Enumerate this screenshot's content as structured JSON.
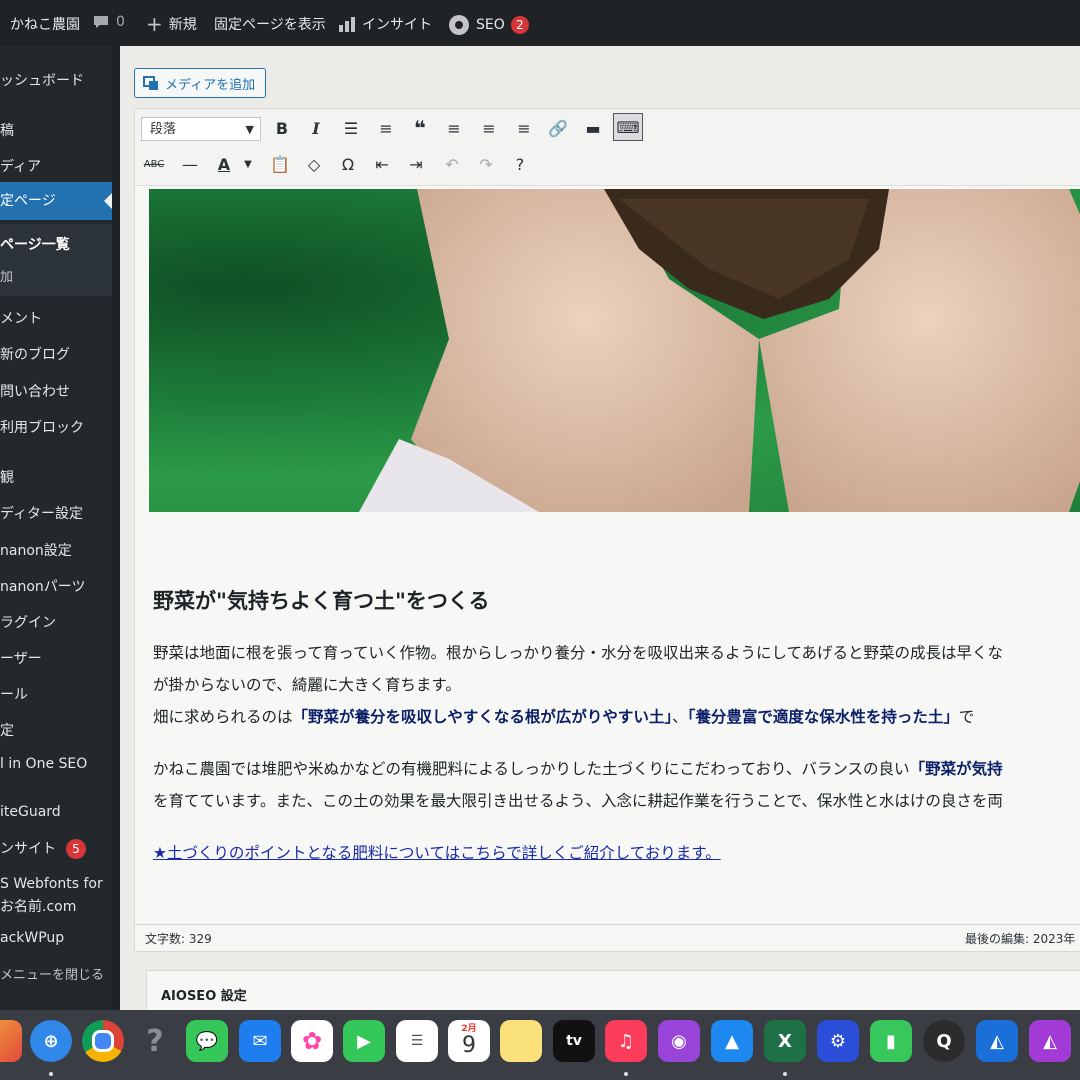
{
  "adminbar": {
    "site_name": "かねこ農園",
    "comments_count": "0",
    "new_label": "新規",
    "view_page_label": "固定ページを表示",
    "insight_label": "インサイト",
    "seo_label": "SEO",
    "seo_badge": "2"
  },
  "sidebar": {
    "items": [
      {
        "label": "ッシュボード"
      },
      {
        "label": "稿"
      },
      {
        "label": "ディア"
      },
      {
        "label": "定ページ"
      },
      {
        "label": "ページ一覧"
      },
      {
        "label": "加"
      },
      {
        "label": "メント"
      },
      {
        "label": "新のブログ"
      },
      {
        "label": "問い合わせ"
      },
      {
        "label": "利用ブロック"
      },
      {
        "label": "観"
      },
      {
        "label": "ディター設定"
      },
      {
        "label": "nanon設定"
      },
      {
        "label": "nanonパーツ"
      },
      {
        "label": "ラグイン"
      },
      {
        "label": "ーザー"
      },
      {
        "label": "ール"
      },
      {
        "label": "定"
      },
      {
        "label": "l in One SEO"
      },
      {
        "label": "iteGuard"
      },
      {
        "label": "ンサイト",
        "badge": "5"
      },
      {
        "label": "S  Webfonts  for"
      },
      {
        "label": "お名前.com"
      },
      {
        "label": "ackWPup"
      },
      {
        "label": "メニューを閉じる"
      }
    ]
  },
  "editor": {
    "media_button": "メディアを追加",
    "format_select": "段落",
    "heading": "野菜が\"気持ちよく育つ土\"をつくる",
    "p1_line1": "野菜は地面に根を張って育っていく作物。根からしっかり養分・水分を吸収出来るようにしてあげると野菜の成長は早くな",
    "p1_line2": "が掛からないので、綺麗に大きく育ちます。",
    "p2_prefix": "畑に求められるのは",
    "p2_bold1": "「野菜が養分を吸収しやすくなる根が広がりやすい土」",
    "p2_mid": "、",
    "p2_bold2": "「養分豊富で適度な保水性を持った土」",
    "p2_suffix": "で",
    "p3_line1_prefix": "かねこ農園では堆肥や米ぬかなどの有機肥料によるしっかりした土づくりにこだわっており、バランスの良い",
    "p3_line1_bold": "「野菜が気持",
    "p3_line2": "を育てています。また、この土の効果を最大限引き出せるよう、入念に耕起作業を行うことで、保水性と水はけの良さを両",
    "link_text": "★土づくりのポイントとなる肥料についてはこちらで詳しくご紹介しております。",
    "word_count": "文字数: 329",
    "last_edit": "最後の編集: 2023年"
  },
  "aioseo": {
    "title": "AIOSEO 設定"
  },
  "dock": {
    "calendar_month": "2月",
    "calendar_day": "9",
    "tv_label": "tv"
  }
}
